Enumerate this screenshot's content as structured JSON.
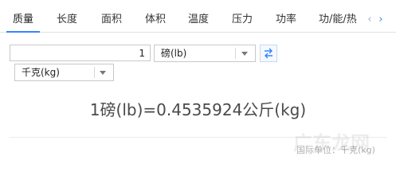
{
  "tabs": [
    {
      "label": "质量",
      "active": true
    },
    {
      "label": "长度",
      "active": false
    },
    {
      "label": "面积",
      "active": false
    },
    {
      "label": "体积",
      "active": false
    },
    {
      "label": "温度",
      "active": false
    },
    {
      "label": "压力",
      "active": false
    },
    {
      "label": "功率",
      "active": false
    },
    {
      "label": "功/能/热",
      "active": false
    }
  ],
  "nav": {
    "prev_icon": "chevron-left-icon",
    "next_icon": "chevron-right-icon",
    "prev": "‹",
    "next": "›"
  },
  "converter": {
    "amount": "1",
    "from_unit": "磅(lb)",
    "to_unit": "千克(kg)",
    "swap_icon": "swap-icon"
  },
  "result": "1磅(lb)=0.4535924公斤(kg)",
  "footnote": "国际单位：千克(kg)",
  "watermark": "广东龙网",
  "colors": {
    "accent": "#3385ff",
    "text": "#4a4a4a"
  }
}
